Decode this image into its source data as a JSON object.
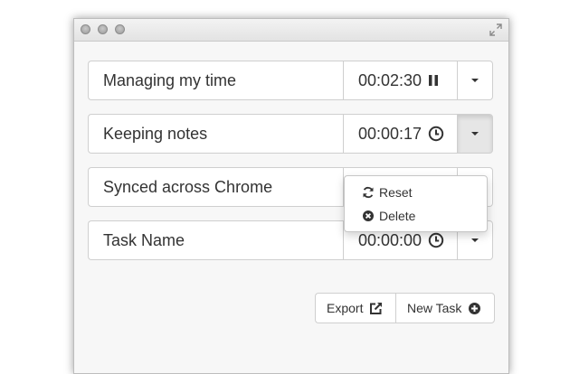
{
  "tasks": [
    {
      "name": "Managing my time",
      "time": "00:02:30",
      "status_icon": "pause-icon"
    },
    {
      "name": "Keeping notes",
      "time": "00:00:17",
      "status_icon": "clock-icon"
    },
    {
      "name": "Synced across Chrome",
      "time": "",
      "status_icon": ""
    },
    {
      "name": "Task Name",
      "time": "00:00:00",
      "status_icon": "clock-icon"
    }
  ],
  "dropdown": {
    "open_for_task": "Keeping notes",
    "items": [
      {
        "label": "Reset",
        "icon": "refresh-icon"
      },
      {
        "label": "Delete",
        "icon": "remove-circle-icon"
      }
    ]
  },
  "footer": {
    "export_label": "Export",
    "export_icon": "external-link-icon",
    "new_task_label": "New Task",
    "new_task_icon": "plus-circle-icon"
  },
  "colors": {
    "text": "#333333",
    "border": "#cfcfcf",
    "window_bg": "#f7f7f7",
    "active_button_bg": "#e6e6e6"
  }
}
